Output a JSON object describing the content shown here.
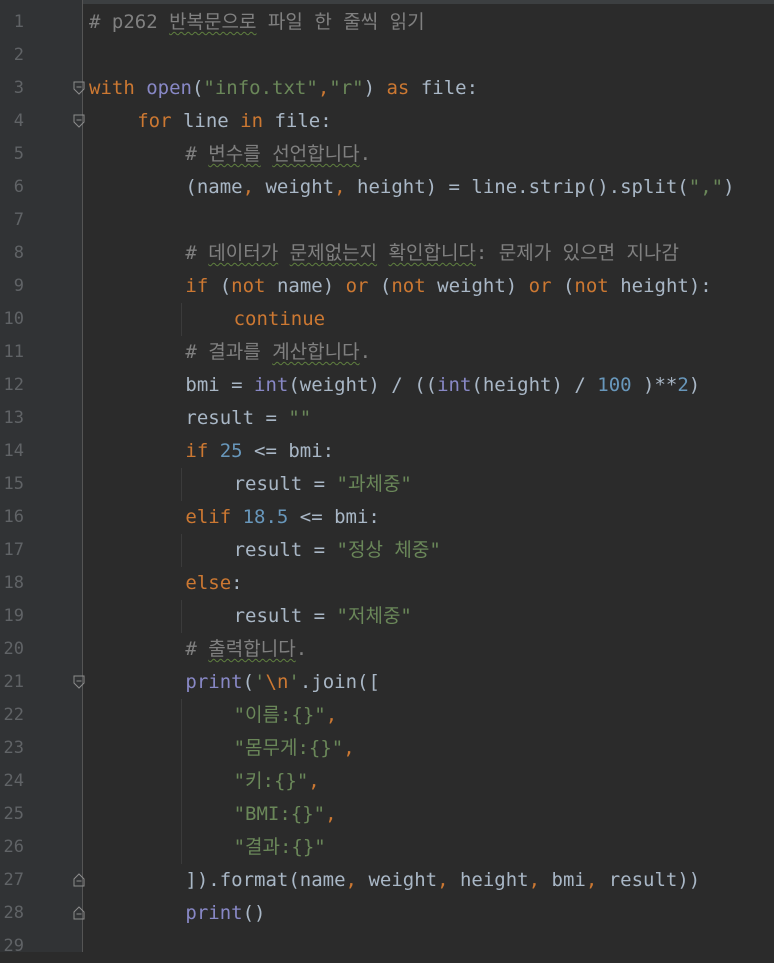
{
  "editor": {
    "lines": [
      {
        "n": "1",
        "indent": 0,
        "tokens": [
          [
            "cm",
            "# p262 "
          ],
          [
            "cm ko",
            "반복문으로"
          ],
          [
            "cm",
            " 파일 한 줄씩 읽기"
          ]
        ]
      },
      {
        "n": "2",
        "indent": 0,
        "tokens": []
      },
      {
        "n": "3",
        "indent": 0,
        "tokens": [
          [
            "kw",
            "with "
          ],
          [
            "bi",
            "open"
          ],
          [
            "",
            "("
          ],
          [
            "st",
            "\"info.txt\""
          ],
          [
            "kw",
            ","
          ],
          [
            "st",
            "\"r\""
          ],
          [
            "",
            ") "
          ],
          [
            "kw",
            "as "
          ],
          [
            "",
            "file:"
          ]
        ]
      },
      {
        "n": "4",
        "indent": 1,
        "tokens": [
          [
            "kw",
            "for "
          ],
          [
            "",
            "line "
          ],
          [
            "kw",
            "in "
          ],
          [
            "",
            "file:"
          ]
        ]
      },
      {
        "n": "5",
        "indent": 2,
        "tokens": [
          [
            "cm",
            "# "
          ],
          [
            "cm ko",
            "변수를"
          ],
          [
            "cm",
            " "
          ],
          [
            "cm ko",
            "선언합니다"
          ],
          [
            "cm",
            "."
          ]
        ]
      },
      {
        "n": "6",
        "indent": 2,
        "tokens": [
          [
            "",
            "(name"
          ],
          [
            "kw",
            ", "
          ],
          [
            "",
            "weight"
          ],
          [
            "kw",
            ", "
          ],
          [
            "",
            "height) = line.strip().split("
          ],
          [
            "st",
            "\",\""
          ],
          [
            "",
            ")"
          ]
        ]
      },
      {
        "n": "7",
        "indent": 0,
        "tokens": []
      },
      {
        "n": "8",
        "indent": 2,
        "tokens": [
          [
            "cm",
            "# "
          ],
          [
            "cm ko",
            "데이터가"
          ],
          [
            "cm",
            " "
          ],
          [
            "cm ko",
            "문제없는지"
          ],
          [
            "cm",
            " "
          ],
          [
            "cm ko",
            "확인합니다"
          ],
          [
            "cm",
            ": 문제가 있으면 지나감"
          ]
        ]
      },
      {
        "n": "9",
        "indent": 2,
        "tokens": [
          [
            "kw",
            "if "
          ],
          [
            "",
            "("
          ],
          [
            "kw",
            "not "
          ],
          [
            "",
            "name) "
          ],
          [
            "kw",
            "or "
          ],
          [
            "",
            "("
          ],
          [
            "kw",
            "not "
          ],
          [
            "",
            "weight) "
          ],
          [
            "kw",
            "or "
          ],
          [
            "",
            "("
          ],
          [
            "kw",
            "not "
          ],
          [
            "",
            "height):"
          ]
        ]
      },
      {
        "n": "10",
        "indent": 3,
        "tokens": [
          [
            "kw",
            "continue"
          ]
        ]
      },
      {
        "n": "11",
        "indent": 2,
        "tokens": [
          [
            "cm",
            "# "
          ],
          [
            "cm",
            "결과를"
          ],
          [
            "cm",
            " "
          ],
          [
            "cm ko",
            "계산합니다"
          ],
          [
            "cm",
            "."
          ]
        ]
      },
      {
        "n": "12",
        "indent": 2,
        "tokens": [
          [
            "",
            "bmi = "
          ],
          [
            "bi",
            "int"
          ],
          [
            "",
            "(weight) / (("
          ],
          [
            "bi",
            "int"
          ],
          [
            "",
            "(height) / "
          ],
          [
            "nm",
            "100"
          ],
          [
            "",
            " )**"
          ],
          [
            "nm",
            "2"
          ],
          [
            "",
            ")"
          ]
        ]
      },
      {
        "n": "13",
        "indent": 2,
        "tokens": [
          [
            "",
            "result = "
          ],
          [
            "st",
            "\"\""
          ]
        ]
      },
      {
        "n": "14",
        "indent": 2,
        "tokens": [
          [
            "kw",
            "if "
          ],
          [
            "nm",
            "25"
          ],
          [
            "",
            " <= bmi:"
          ]
        ]
      },
      {
        "n": "15",
        "indent": 3,
        "tokens": [
          [
            "",
            "result = "
          ],
          [
            "st",
            "\"과체중\""
          ]
        ]
      },
      {
        "n": "16",
        "indent": 2,
        "tokens": [
          [
            "kw",
            "elif "
          ],
          [
            "nm",
            "18.5"
          ],
          [
            "",
            " <= bmi:"
          ]
        ]
      },
      {
        "n": "17",
        "indent": 3,
        "tokens": [
          [
            "",
            "result = "
          ],
          [
            "st",
            "\"정상 체중\""
          ]
        ]
      },
      {
        "n": "18",
        "indent": 2,
        "tokens": [
          [
            "kw",
            "else"
          ],
          [
            "",
            ":"
          ]
        ]
      },
      {
        "n": "19",
        "indent": 3,
        "tokens": [
          [
            "",
            "result = "
          ],
          [
            "st",
            "\"저체중\""
          ]
        ]
      },
      {
        "n": "20",
        "indent": 2,
        "tokens": [
          [
            "cm",
            "# "
          ],
          [
            "cm ko",
            "출력합니다"
          ],
          [
            "cm",
            "."
          ]
        ]
      },
      {
        "n": "21",
        "indent": 2,
        "tokens": [
          [
            "bi",
            "print"
          ],
          [
            "",
            "("
          ],
          [
            "st",
            "'"
          ],
          [
            "es",
            "\\n"
          ],
          [
            "st",
            "'"
          ],
          [
            "",
            ".join(["
          ]
        ]
      },
      {
        "n": "22",
        "indent": 3,
        "tokens": [
          [
            "st",
            "\"이름:{}\""
          ],
          [
            "kw",
            ","
          ]
        ]
      },
      {
        "n": "23",
        "indent": 3,
        "tokens": [
          [
            "st",
            "\"몸무게:{}\""
          ],
          [
            "kw",
            ","
          ]
        ]
      },
      {
        "n": "24",
        "indent": 3,
        "tokens": [
          [
            "st",
            "\"키:{}\""
          ],
          [
            "kw",
            ","
          ]
        ]
      },
      {
        "n": "25",
        "indent": 3,
        "tokens": [
          [
            "st",
            "\"BMI:{}\""
          ],
          [
            "kw",
            ","
          ]
        ]
      },
      {
        "n": "26",
        "indent": 3,
        "tokens": [
          [
            "st",
            "\"결과:{}\""
          ]
        ]
      },
      {
        "n": "27",
        "indent": 2,
        "tokens": [
          [
            "",
            "]).format(name"
          ],
          [
            "kw",
            ", "
          ],
          [
            "",
            "weight"
          ],
          [
            "kw",
            ", "
          ],
          [
            "",
            "height"
          ],
          [
            "kw",
            ", "
          ],
          [
            "",
            "bmi"
          ],
          [
            "kw",
            ", "
          ],
          [
            "",
            "result))"
          ]
        ]
      },
      {
        "n": "28",
        "indent": 2,
        "tokens": [
          [
            "bi",
            "print"
          ],
          [
            "",
            "()"
          ]
        ]
      },
      {
        "n": "29",
        "indent": 0,
        "tokens": []
      }
    ],
    "folds": [
      {
        "line": 3,
        "kind": "open"
      },
      {
        "line": 4,
        "kind": "open"
      },
      {
        "line": 21,
        "kind": "open"
      },
      {
        "line": 27,
        "kind": "close"
      },
      {
        "line": 28,
        "kind": "close"
      }
    ]
  }
}
